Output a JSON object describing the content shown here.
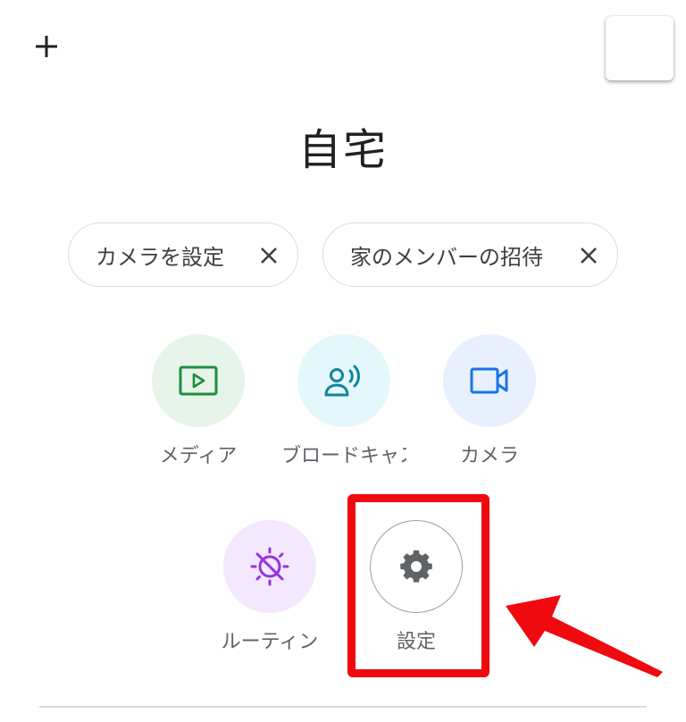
{
  "header": {
    "add_icon": "plus-icon",
    "avatar": "account-avatar"
  },
  "home": {
    "title": "自宅"
  },
  "chips": [
    {
      "label": "カメラを設定",
      "close_icon": "close-icon"
    },
    {
      "label": "家のメンバーの招待",
      "close_icon": "close-icon"
    }
  ],
  "tiles": {
    "media": {
      "label": "メディア",
      "icon": "play-icon",
      "color": "#1e8e3e",
      "bg": "#e6f4ea"
    },
    "cast": {
      "label": "ブロードキャスト",
      "icon": "broadcast-icon",
      "color": "#12849a",
      "bg": "#e4f7fb"
    },
    "camera": {
      "label": "カメラ",
      "icon": "video-camera-icon",
      "color": "#1a73e8",
      "bg": "#e8f0fe"
    },
    "routine": {
      "label": "ルーティン",
      "icon": "routine-sun-icon",
      "color": "#9334e6",
      "bg": "#f3e8fd"
    },
    "settings": {
      "label": "設定",
      "icon": "gear-icon",
      "color": "#5f6368",
      "bg": "#ffffff"
    }
  },
  "annotation": {
    "highlight_color": "#ee0a0f"
  }
}
